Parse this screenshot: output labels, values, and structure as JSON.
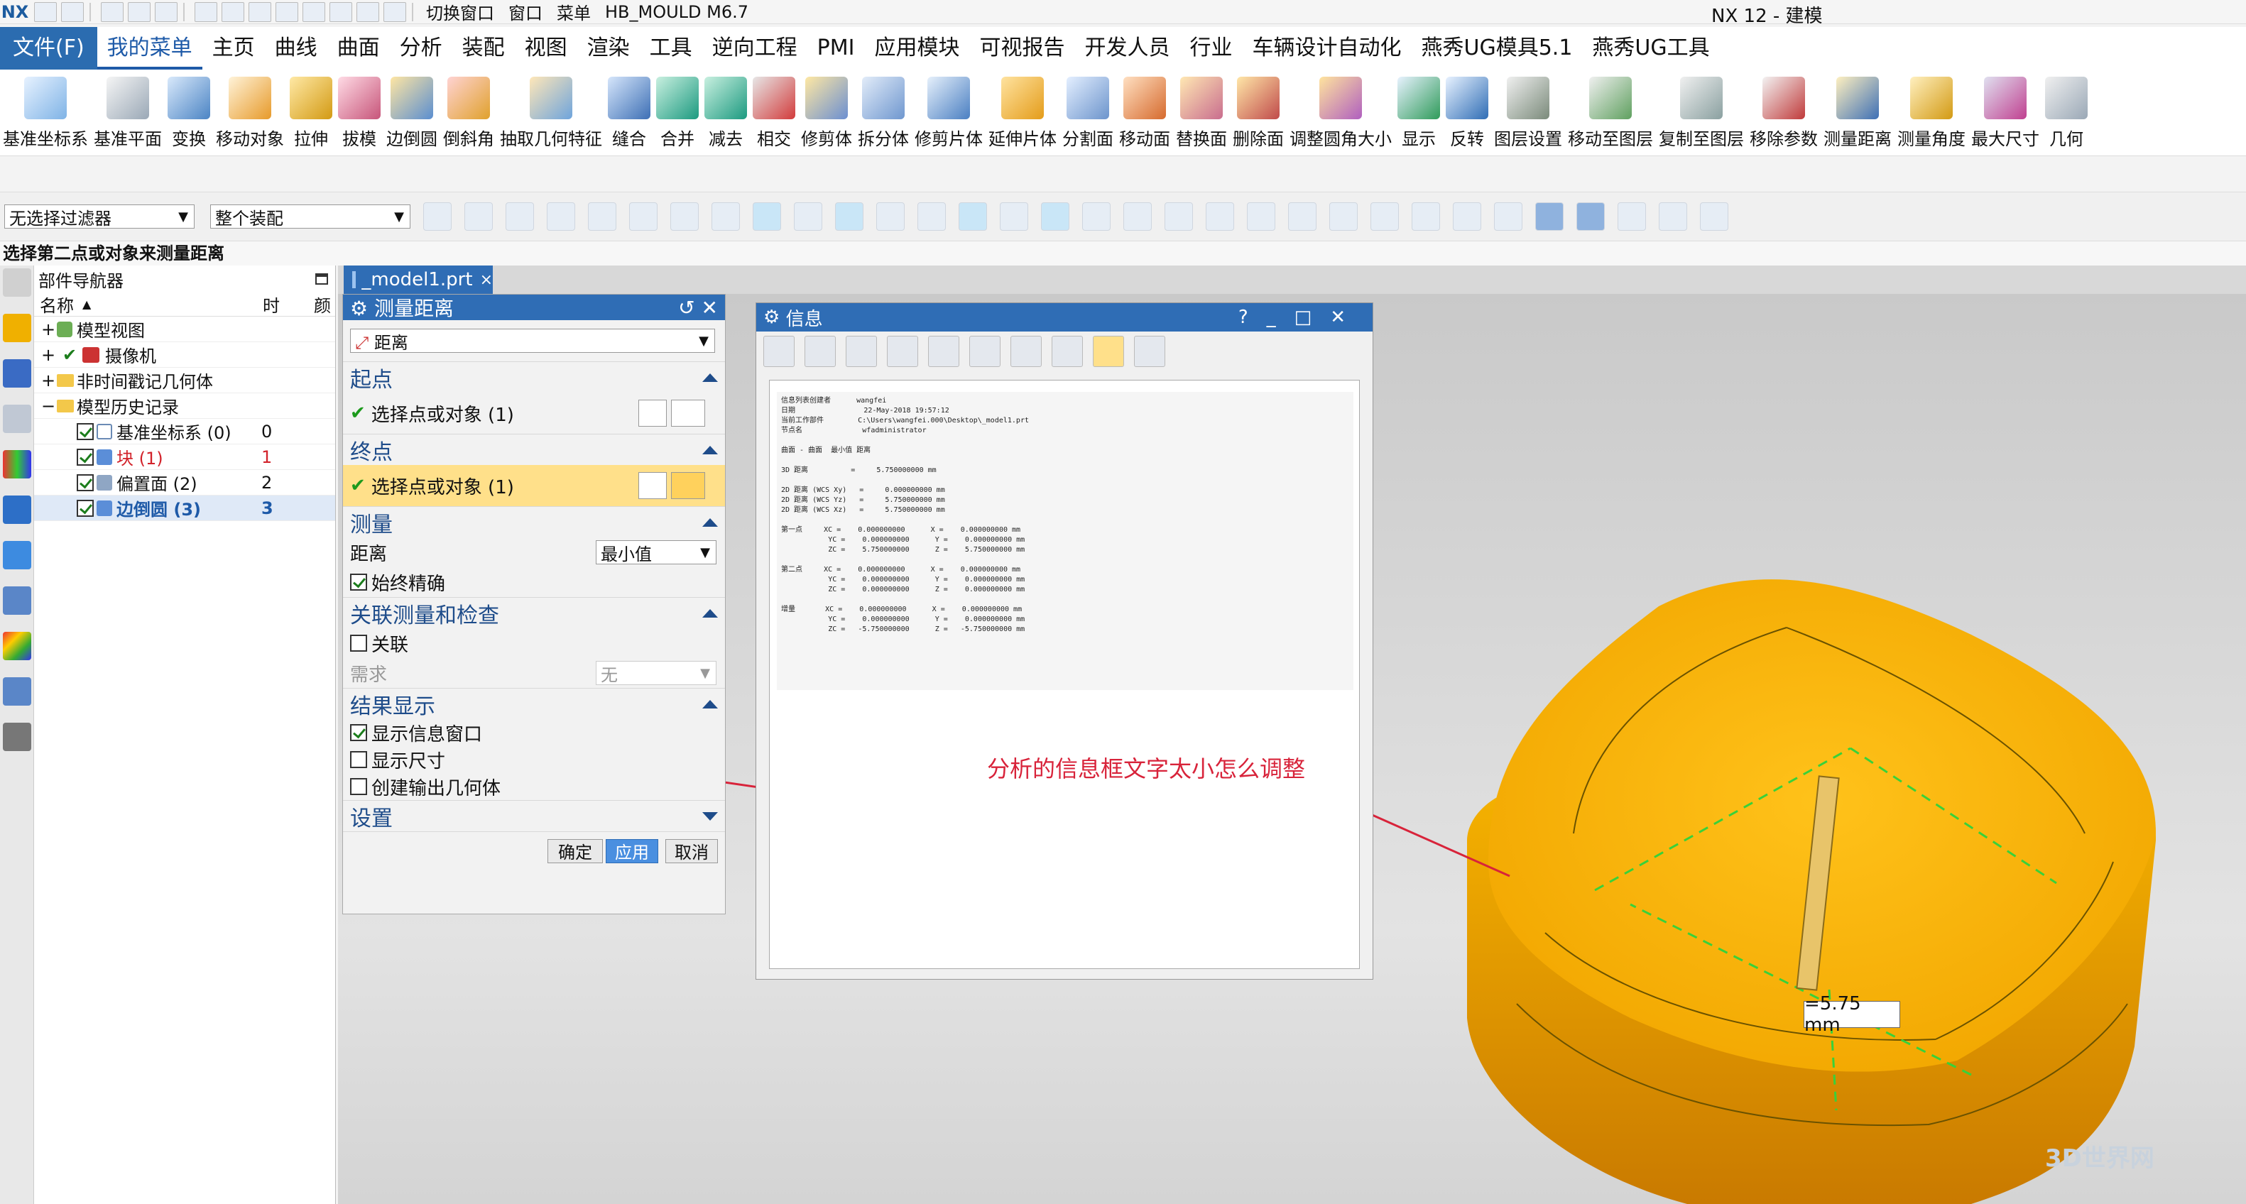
{
  "titlebar": {
    "logo": "NX",
    "switch_window": "切换窗口",
    "window": "窗口",
    "menu": "菜单",
    "plugin": "HB_MOULD M6.7",
    "app_title": "NX 12 - 建模"
  },
  "menubar": [
    "文件(F)",
    "我的菜单",
    "主页",
    "曲线",
    "曲面",
    "分析",
    "装配",
    "视图",
    "渲染",
    "工具",
    "逆向工程",
    "PMI",
    "应用模块",
    "可视报告",
    "开发人员",
    "行业",
    "车辆设计自动化",
    "燕秀UG模具5.1",
    "燕秀UG工具"
  ],
  "ribbon": [
    "基准坐标系",
    "基准平面",
    "变换",
    "移动对象",
    "拉伸",
    "拔模",
    "边倒圆",
    "倒斜角",
    "抽取几何特征",
    "缝合",
    "合并",
    "减去",
    "相交",
    "修剪体",
    "拆分体",
    "修剪片体",
    "延伸片体",
    "分割面",
    "移动面",
    "替换面",
    "删除面",
    "调整圆角大小",
    "显示",
    "反转",
    "图层设置",
    "移动至图层",
    "复制至图层",
    "移除参数",
    "测量距离",
    "测量角度",
    "最大尺寸",
    "几何"
  ],
  "selection": {
    "filter": "无选择过滤器",
    "scope": "整个装配"
  },
  "status": "选择第二点或对象来测量距离",
  "navigator": {
    "title": "部件导航器",
    "col_name": "名称",
    "col_time": "时",
    "col_color": "颜",
    "rows": [
      {
        "label": "模型视图",
        "num": ""
      },
      {
        "label": "摄像机",
        "num": ""
      },
      {
        "label": "非时间戳记几何体",
        "num": ""
      },
      {
        "label": "模型历史记录",
        "num": ""
      },
      {
        "label": "基准坐标系 (0)",
        "num": "0"
      },
      {
        "label": "块 (1)",
        "num": "1"
      },
      {
        "label": "偏置面 (2)",
        "num": "2"
      },
      {
        "label": "边倒圆 (3)",
        "num": "3"
      }
    ]
  },
  "tab": "_model1.prt",
  "measure": {
    "title": "测量距离",
    "type": "距离",
    "start_section": "起点",
    "start_select": "选择点或对象 (1)",
    "end_section": "终点",
    "end_select": "选择点或对象 (1)",
    "measure_section": "测量",
    "distance_label": "距离",
    "distance_mode": "最小值",
    "always_precise": "始终精确",
    "assoc_section": "关联测量和检查",
    "assoc": "关联",
    "requirement": "需求",
    "requirement_value": "无",
    "result_section": "结果显示",
    "show_info": "显示信息窗口",
    "show_dim": "显示尺寸",
    "create_output": "创建输出几何体",
    "settings_section": "设置",
    "ok": "确定",
    "apply": "应用",
    "cancel": "取消"
  },
  "info": {
    "title": "信息",
    "text": "信息列表创建者      wangfei\n日期                22-May-2018 19:57:12\n当前工作部件        C:\\Users\\wangfei.000\\Desktop\\_model1.prt\n节点名              wfadministrator\n\n曲面 - 曲面  最小值 距离\n\n3D 距离          =     5.750000000 mm\n\n2D 距离 (WCS Xy)   =     0.000000000 mm\n2D 距离 (WCS Yz)   =     5.750000000 mm\n2D 距离 (WCS Xz)   =     5.750000000 mm\n\n第一点     XC =    0.000000000      X =    0.000000000 mm\n           YC =    0.000000000      Y =    0.000000000 mm\n           ZC =    5.750000000      Z =    5.750000000 mm\n\n第二点     XC =    0.000000000      X =    0.000000000 mm\n           YC =    0.000000000      Y =    0.000000000 mm\n           ZC =    0.000000000      Z =    0.000000000 mm\n\n增量       XC =    0.000000000      X =    0.000000000 mm\n           YC =    0.000000000      Y =    0.000000000 mm\n           ZC =   -5.750000000      Z =   -5.750000000 mm"
  },
  "annotation": "分析的信息框文字太小怎么调整",
  "dimension_label": "=5.75 mm",
  "watermark": "3D世界网",
  "colors": {
    "accent": "#2f6db5",
    "model": "#f2b200",
    "annotation": "#d8233a"
  }
}
